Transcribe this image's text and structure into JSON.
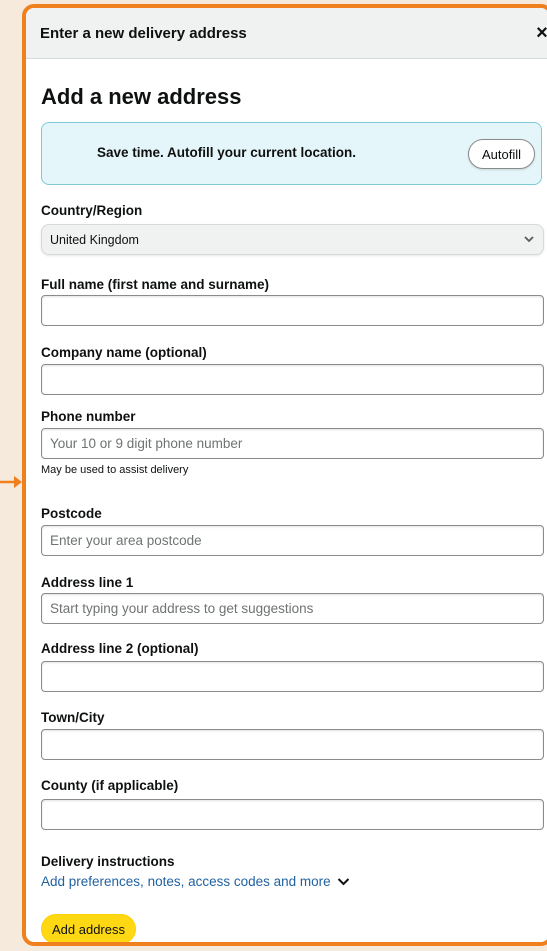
{
  "header": {
    "title": "Enter a new delivery address",
    "close_symbol": "×"
  },
  "page_title": "Add a new address",
  "autofill": {
    "text": "Save time. Autofill your current location.",
    "button_label": "Autofill"
  },
  "fields": {
    "country": {
      "label": "Country/Region",
      "value": "United Kingdom"
    },
    "full_name": {
      "label": "Full name (first name and surname)",
      "value": "",
      "placeholder": ""
    },
    "company": {
      "label": "Company name (optional)",
      "value": "",
      "placeholder": ""
    },
    "phone": {
      "label": "Phone number",
      "value": "",
      "placeholder": "Your 10 or 9 digit phone number",
      "hint": "May be used to assist delivery"
    },
    "postcode": {
      "label": "Postcode",
      "value": "",
      "placeholder": "Enter your area postcode"
    },
    "address1": {
      "label": "Address line 1",
      "value": "",
      "placeholder": "Start typing your address to get suggestions"
    },
    "address2": {
      "label": "Address line 2 (optional)",
      "value": "",
      "placeholder": ""
    },
    "town": {
      "label": "Town/City",
      "value": "",
      "placeholder": ""
    },
    "county": {
      "label": "County (if applicable)",
      "value": "",
      "placeholder": ""
    }
  },
  "delivery_instructions": {
    "label": "Delivery instructions",
    "link": "Add preferences, notes, access codes and more"
  },
  "submit": {
    "label": "Add address"
  },
  "colors": {
    "highlight_border": "#f07f1d",
    "button_yellow": "#ffd814",
    "autofill_bg": "#e5f6fa",
    "link_blue": "#2162a1"
  }
}
